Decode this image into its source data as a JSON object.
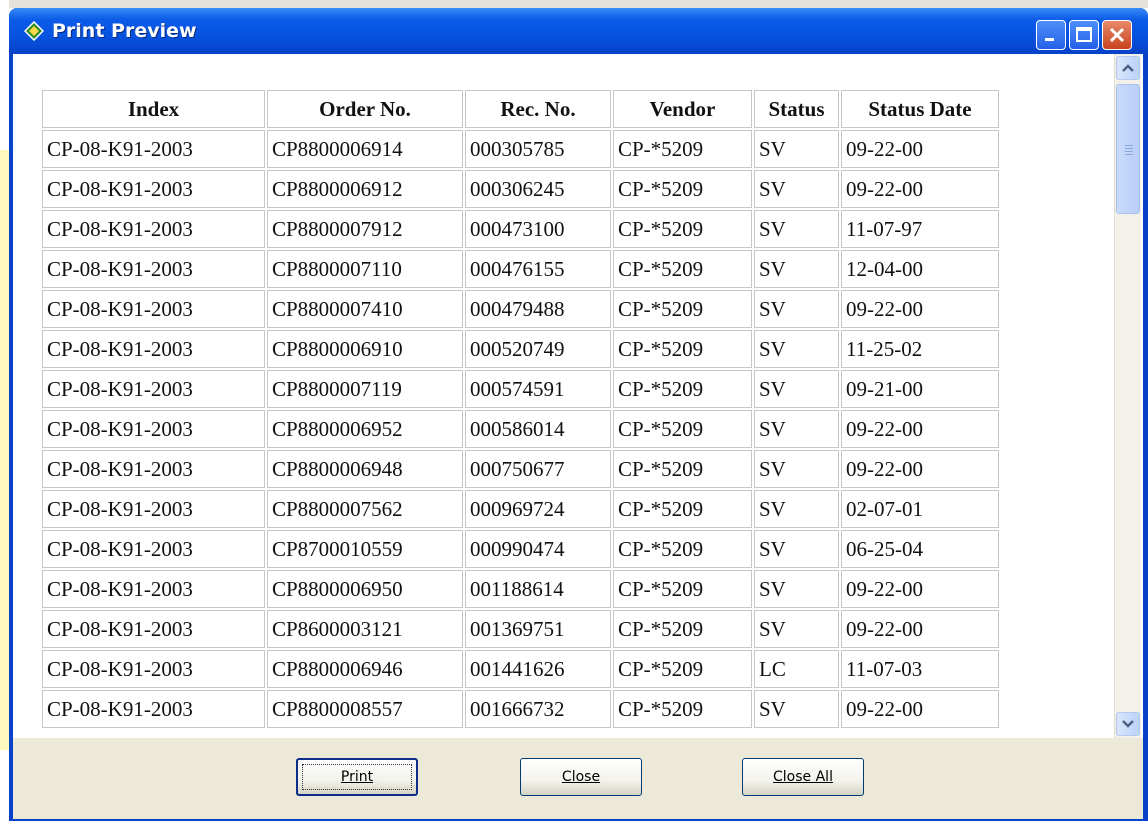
{
  "window": {
    "title": "Print Preview",
    "controls": [
      "minimize-icon",
      "maximize-icon",
      "close-icon"
    ]
  },
  "table": {
    "columns": [
      "Index",
      "Order No.",
      "Rec. No.",
      "Vendor",
      "Status",
      "Status Date"
    ],
    "rows": [
      [
        "CP-08-K91-2003",
        "CP8800006914",
        "000305785",
        "CP-*5209",
        "SV",
        "09-22-00"
      ],
      [
        "CP-08-K91-2003",
        "CP8800006912",
        "000306245",
        "CP-*5209",
        "SV",
        "09-22-00"
      ],
      [
        "CP-08-K91-2003",
        "CP8800007912",
        "000473100",
        "CP-*5209",
        "SV",
        "11-07-97"
      ],
      [
        "CP-08-K91-2003",
        "CP8800007110",
        "000476155",
        "CP-*5209",
        "SV",
        "12-04-00"
      ],
      [
        "CP-08-K91-2003",
        "CP8800007410",
        "000479488",
        "CP-*5209",
        "SV",
        "09-22-00"
      ],
      [
        "CP-08-K91-2003",
        "CP8800006910",
        "000520749",
        "CP-*5209",
        "SV",
        "11-25-02"
      ],
      [
        "CP-08-K91-2003",
        "CP8800007119",
        "000574591",
        "CP-*5209",
        "SV",
        "09-21-00"
      ],
      [
        "CP-08-K91-2003",
        "CP8800006952",
        "000586014",
        "CP-*5209",
        "SV",
        "09-22-00"
      ],
      [
        "CP-08-K91-2003",
        "CP8800006948",
        "000750677",
        "CP-*5209",
        "SV",
        "09-22-00"
      ],
      [
        "CP-08-K91-2003",
        "CP8800007562",
        "000969724",
        "CP-*5209",
        "SV",
        "02-07-01"
      ],
      [
        "CP-08-K91-2003",
        "CP8700010559",
        "000990474",
        "CP-*5209",
        "SV",
        "06-25-04"
      ],
      [
        "CP-08-K91-2003",
        "CP8800006950",
        "001188614",
        "CP-*5209",
        "SV",
        "09-22-00"
      ],
      [
        "CP-08-K91-2003",
        "CP8600003121",
        "001369751",
        "CP-*5209",
        "SV",
        "09-22-00"
      ],
      [
        "CP-08-K91-2003",
        "CP8800006946",
        "001441626",
        "CP-*5209",
        "LC",
        "11-07-03"
      ],
      [
        "CP-08-K91-2003",
        "CP8800008557",
        "001666732",
        "CP-*5209",
        "SV",
        "09-22-00"
      ]
    ]
  },
  "buttons": {
    "print": "Print",
    "close": "Close",
    "close_all": "Close All"
  },
  "colors": {
    "titlebar": "#0653e0",
    "dialog_face": "#ece9d8",
    "close_button": "#c9421d"
  }
}
